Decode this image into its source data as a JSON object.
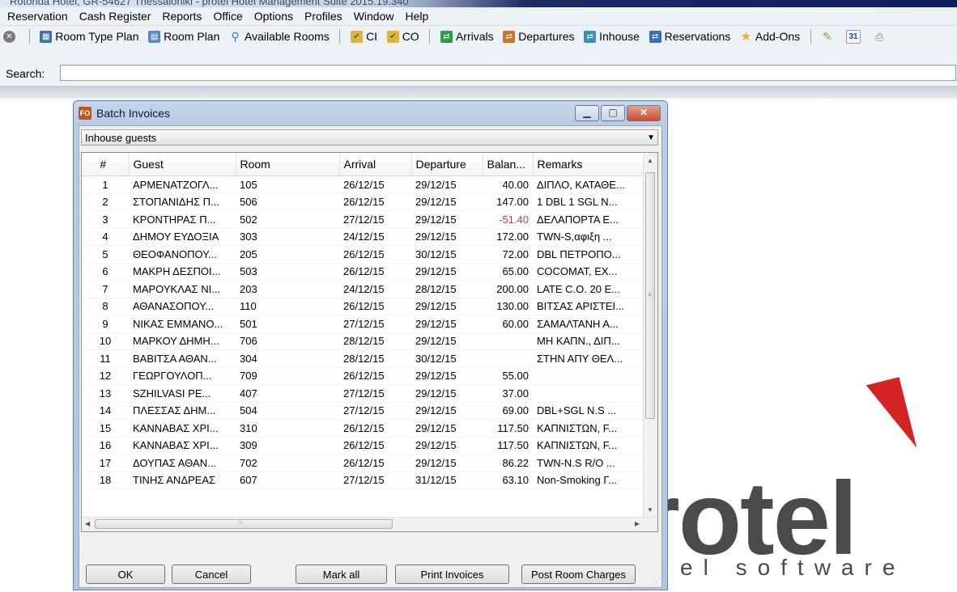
{
  "app": {
    "title": "Rotonda Hotel, GR-54627 Thessaloniki - protel Hotel Management Suite 2015.19.340"
  },
  "menu": [
    "Reservation",
    "Cash Register",
    "Reports",
    "Office",
    "Options",
    "Profiles",
    "Window",
    "Help"
  ],
  "toolbar": {
    "room_type_plan": "Room Type Plan",
    "room_plan": "Room Plan",
    "available_rooms": "Available Rooms",
    "ci": "CI",
    "co": "CO",
    "arrivals": "Arrivals",
    "departures": "Departures",
    "inhouse": "Inhouse",
    "reservations": "Reservations",
    "add_ons": "Add-Ons",
    "calendar_day": "31"
  },
  "search": {
    "label": "Search:",
    "value": ""
  },
  "logo": {
    "main": "rotel",
    "sub": "el software"
  },
  "dialog": {
    "title": "Batch Invoices",
    "icon_text": "FO",
    "filter": "Inhouse guests",
    "columns": [
      "#",
      "Guest",
      "Room",
      "Arrival",
      "Departure",
      "Balan...",
      "Remarks"
    ],
    "rows": [
      {
        "n": "1",
        "guest": "ΑΡΜΕΝΑΤΖΟΓΛ...",
        "room": "105",
        "arrival": "26/12/15",
        "departure": "29/12/15",
        "balance": "40.00",
        "remarks": "ΔΙΠΛΟ, ΚΑΤΑΘΕ..."
      },
      {
        "n": "2",
        "guest": "ΣΤΟΠΑΝΙΔΗΣ Π...",
        "room": "506",
        "arrival": "26/12/15",
        "departure": "29/12/15",
        "balance": "147.00",
        "remarks": "1 DBL 1 SGL N..."
      },
      {
        "n": "3",
        "guest": "ΚΡΟΝΤΗΡΑΣ Π...",
        "room": "502",
        "arrival": "27/12/15",
        "departure": "29/12/15",
        "balance": "-51.40",
        "remarks": "ΔΕΛΑΠΟΡΤΑ Ε..."
      },
      {
        "n": "4",
        "guest": "ΔΗΜΟΥ ΕΥΔΟΞΙΑ",
        "room": "303",
        "arrival": "24/12/15",
        "departure": "29/12/15",
        "balance": "172.00",
        "remarks": "TWN-S,αφιξη ..."
      },
      {
        "n": "5",
        "guest": "ΘΕΟΦΑΝΟΠΟΥ...",
        "room": "205",
        "arrival": "26/12/15",
        "departure": "30/12/15",
        "balance": "72.00",
        "remarks": "DBL ΠΕΤΡΟΠΟ..."
      },
      {
        "n": "6",
        "guest": "ΜΑΚΡΗ ΔΕΣΠΟΙ...",
        "room": "503",
        "arrival": "26/12/15",
        "departure": "29/12/15",
        "balance": "65.00",
        "remarks": "COCOMAT, EX..."
      },
      {
        "n": "7",
        "guest": "ΜΑΡΟΥΚΛΑΣ ΝΙ...",
        "room": "203",
        "arrival": "24/12/15",
        "departure": "28/12/15",
        "balance": "200.00",
        "remarks": "LATE C.O. 20 E..."
      },
      {
        "n": "8",
        "guest": "ΑΘΑΝΑΣΟΠΟΥ...",
        "room": "110",
        "arrival": "26/12/15",
        "departure": "29/12/15",
        "balance": "130.00",
        "remarks": "ΒΙΤΣΑΣ ΑΡΙΣΤΕΙ..."
      },
      {
        "n": "9",
        "guest": "ΝΙΚΑΣ ΕΜΜΑΝΟ...",
        "room": "501",
        "arrival": "27/12/15",
        "departure": "29/12/15",
        "balance": "60.00",
        "remarks": "ΣΑΜΑΛΤΑΝΗ Α..."
      },
      {
        "n": "10",
        "guest": "ΜΑΡΚΟΥ ΔΗΜΗ...",
        "room": "706",
        "arrival": "28/12/15",
        "departure": "29/12/15",
        "balance": "",
        "remarks": "ΜΗ ΚΑΠΝ., ΔΙΠ..."
      },
      {
        "n": "11",
        "guest": "ΒΑΒΙΤΣΑ ΑΘΑΝ...",
        "room": "304",
        "arrival": "28/12/15",
        "departure": "30/12/15",
        "balance": "",
        "remarks": "ΣΤΗΝ ΑΠΥ ΘΕΛ..."
      },
      {
        "n": "12",
        "guest": "ΓΕΩΡΓΟΥΛΟΠ...",
        "room": "709",
        "arrival": "26/12/15",
        "departure": "29/12/15",
        "balance": "55.00",
        "remarks": ""
      },
      {
        "n": "13",
        "guest": "SZHILVASI PE...",
        "room": "407",
        "arrival": "27/12/15",
        "departure": "29/12/15",
        "balance": "37.00",
        "remarks": ""
      },
      {
        "n": "14",
        "guest": "ΠΛΕΣΣΑΣ ΔΗΜ...",
        "room": "504",
        "arrival": "27/12/15",
        "departure": "29/12/15",
        "balance": "69.00",
        "remarks": "DBL+SGL N.S ..."
      },
      {
        "n": "15",
        "guest": "ΚΑΝΝΑΒΑΣ ΧΡΙ...",
        "room": "310",
        "arrival": "26/12/15",
        "departure": "29/12/15",
        "balance": "117.50",
        "remarks": "ΚΑΠΝΙΣΤΩΝ, F..."
      },
      {
        "n": "16",
        "guest": "ΚΑΝΝΑΒΑΣ ΧΡΙ...",
        "room": "309",
        "arrival": "26/12/15",
        "departure": "29/12/15",
        "balance": "117.50",
        "remarks": "ΚΑΠΝΙΣΤΩΝ, F..."
      },
      {
        "n": "17",
        "guest": "ΔΟΥΠΑΣ ΑΘΑΝ...",
        "room": "702",
        "arrival": "26/12/15",
        "departure": "29/12/15",
        "balance": "86.22",
        "remarks": "TWN-N.S R/O ..."
      },
      {
        "n": "18",
        "guest": "ΤΙΝΗΣ ΑΝΔΡΕΑΣ",
        "room": "607",
        "arrival": "27/12/15",
        "departure": "31/12/15",
        "balance": "63.10",
        "remarks": "Non-Smoking Γ..."
      }
    ],
    "buttons": {
      "ok": "OK",
      "cancel": "Cancel",
      "mark_all": "Mark all",
      "print_invoices": "Print Invoices",
      "post_room_charges": "Post Room Charges"
    }
  },
  "colors": {
    "negative_balance": "#e03030",
    "logo_accent": "#d42323"
  }
}
